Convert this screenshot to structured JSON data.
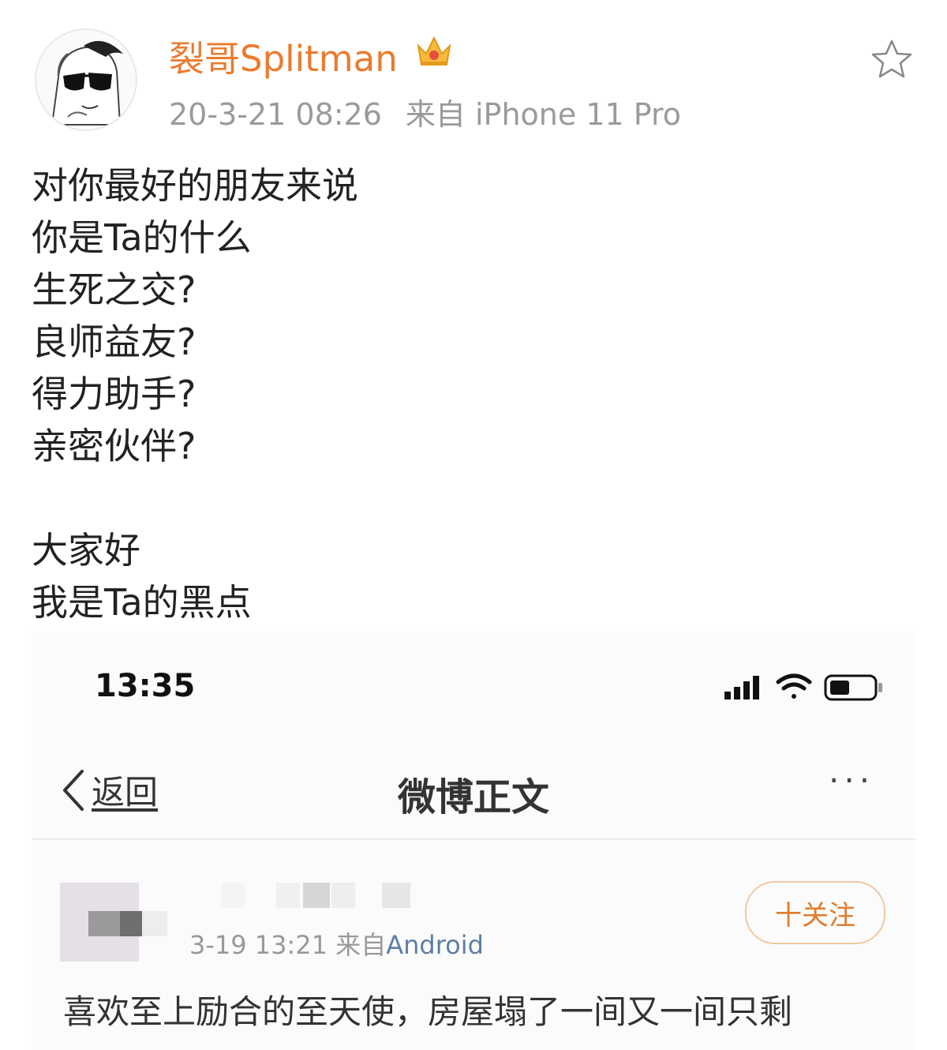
{
  "post": {
    "author": "裂哥Splitman",
    "timestamp": "20-3-21 08:26",
    "source": "来自 iPhone 11 Pro",
    "lines": [
      "对你最好的朋友来说",
      "你是Ta的什么",
      "生死之交?",
      "良师益友?",
      "得力助手?",
      "亲密伙伴?"
    ],
    "lines2": [
      "大家好",
      "我是Ta的黑点"
    ]
  },
  "screenshot": {
    "status_time": "13:35",
    "back_label": "返回",
    "nav_title": "微博正文",
    "more_label": "···",
    "post_meta_time": "3-19 13:21",
    "post_meta_source_prefix": "来自",
    "post_meta_source": "Android",
    "follow_label": "十关注",
    "text_line": "喜欢至上励合的至天使，房屋塌了一间又一间只剩"
  },
  "colors": {
    "author": "#eb7b2e",
    "meta": "#9a9a9a",
    "follow": "#e07b2a",
    "android": "#5d7fa7"
  }
}
